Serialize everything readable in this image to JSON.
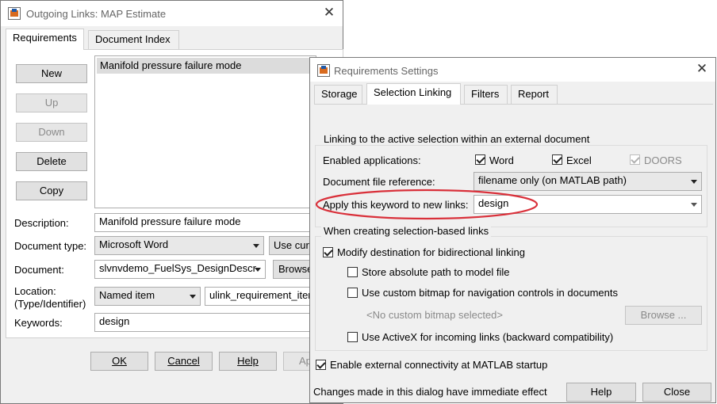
{
  "outgoing": {
    "title": "Outgoing Links: MAP Estimate",
    "tabs": [
      "Requirements",
      "Document Index"
    ],
    "buttons": {
      "new": "New",
      "up": "Up",
      "down": "Down",
      "delete": "Delete",
      "copy": "Copy"
    },
    "list_items": [
      "Manifold pressure failure mode"
    ],
    "description_label": "Description:",
    "description_value": "Manifold pressure failure mode",
    "doctype_label": "Document type:",
    "doctype_value": "Microsoft Word",
    "use_current_label": "Use curr",
    "document_label": "Document:",
    "document_value": "slvnvdemo_FuelSys_DesignDescr",
    "browse_label": "Browse",
    "location_label_1": "Location:",
    "location_label_2": "(Type/Identifier)",
    "location_type": "Named item",
    "location_id": "ulink_requirement_item",
    "keywords_label": "Keywords:",
    "keywords_value": "design",
    "footer": {
      "ok": "OK",
      "cancel": "Cancel",
      "help": "Help",
      "apply": "Ap"
    }
  },
  "settings": {
    "title": "Requirements Settings",
    "tabs": [
      "Storage",
      "Selection Linking",
      "Filters",
      "Report"
    ],
    "active_tab": "Selection Linking",
    "group1_legend": "Linking to the active selection within an external document",
    "enabled_apps_label": "Enabled applications:",
    "apps": [
      {
        "label": "Word",
        "checked": true,
        "enabled": true
      },
      {
        "label": "Excel",
        "checked": true,
        "enabled": true
      },
      {
        "label": "DOORS",
        "checked": true,
        "enabled": false
      }
    ],
    "doc_ref_label": "Document file reference:",
    "doc_ref_value": "filename only (on MATLAB path)",
    "keyword_label": "Apply this keyword to new links:",
    "keyword_value": "design",
    "group2_legend": "When creating selection-based links",
    "modify_dest": "Modify destination for bidirectional linking",
    "store_abs": "Store absolute path to model file",
    "custom_bitmap": "Use custom bitmap for navigation controls in documents",
    "no_bitmap": "<No custom bitmap selected>",
    "browse_disabled": "Browse ...",
    "activex": "Use ActiveX for incoming links (backward compatibility)",
    "enable_external": "Enable external connectivity at MATLAB startup",
    "status": "Changes made in this dialog have immediate effect",
    "help": "Help",
    "close": "Close"
  },
  "colors": {
    "highlight_ellipse": "#d9303a",
    "dialog_bg": "#f0f0f0",
    "list_selection": "#dcdcdc"
  }
}
